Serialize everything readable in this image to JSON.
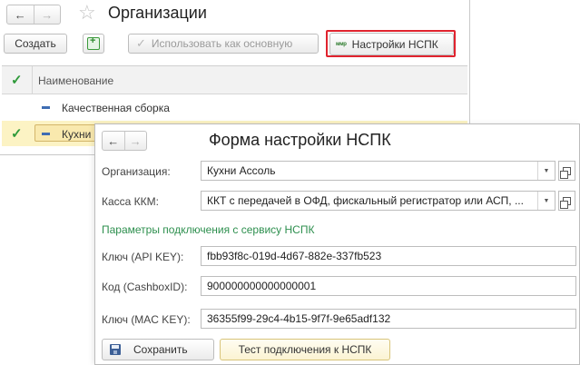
{
  "main": {
    "title": "Организации",
    "nav_back": "←",
    "nav_forward": "→",
    "favorite_star": "☆",
    "toolbar": {
      "create_label": "Создать",
      "use_as_main_label": "Использовать как основную",
      "use_check": "✓",
      "nspk_logo": "ммр",
      "nspk_settings_label": "Настройки НСПК"
    },
    "grid": {
      "header_check": "✓",
      "column_name": "Наименование",
      "rows": [
        {
          "name": "Качественная сборка",
          "selected": false
        },
        {
          "name": "Кухни",
          "selected": true,
          "check": "✓"
        }
      ]
    }
  },
  "form": {
    "title": "Форма настройки НСПК",
    "nav_back": "←",
    "nav_forward": "→",
    "organization_label": "Организация:",
    "organization_value": "Кухни Ассоль",
    "kkm_label": "Касса ККМ:",
    "kkm_value": "ККТ с передачей в ОФД, фискальный регистратор или АСП, ...",
    "dropdown_glyph": "▼",
    "section_title": "Параметры подключения с сервису НСПК",
    "api_key_label": "Ключ (API KEY):",
    "api_key_value": "fbb93f8c-019d-4d67-882e-337fb523",
    "cashbox_label": "Код (CashboxID):",
    "cashbox_value": "900000000000000001",
    "mac_key_label": "Ключ (MAC KEY):",
    "mac_key_value": "36355f99-29c4-4b15-9f7f-9e65adf132",
    "save_label": "Сохранить",
    "test_label": "Тест подключения к НСПК"
  },
  "colors": {
    "accent_green": "#2f9a3a",
    "highlight_red": "#e0232e",
    "selected_row": "#fcf3c4"
  }
}
